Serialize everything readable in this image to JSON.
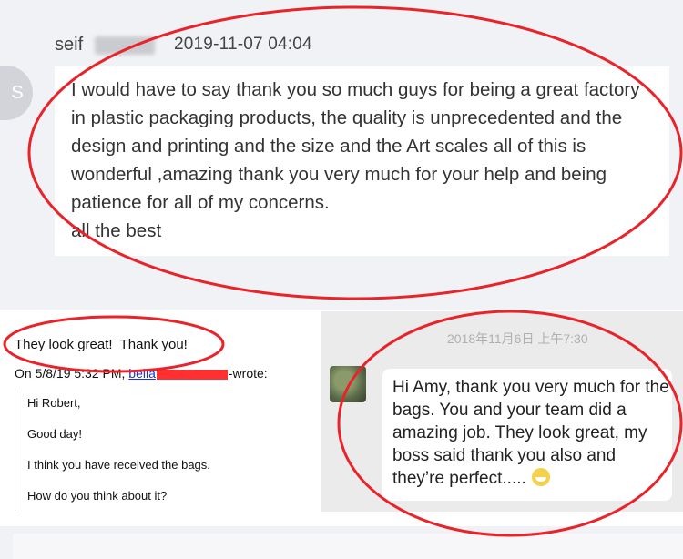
{
  "review": {
    "avatar_letter": "S",
    "author": "seif",
    "timestamp": "2019-11-07 04:04",
    "message": "I would have to say thank you so much guys for being a great factory\nin plastic packaging products, the quality is unprecedented and the\ndesign and printing and the size and the Art scales all of this is\nwonderful ,amazing thank you very much for your help and being\npatience for all of my concerns.\nall the best"
  },
  "email": {
    "reply": "They look great!  Thank you!",
    "on_prefix": "On 5/8/19 5:32 PM, ",
    "sender_link": "bella",
    "wrote": "-wrote:",
    "quoted_lines": [
      "Hi Robert,",
      "Good day!",
      "I think you have received the bags.",
      "How do you think about it?"
    ]
  },
  "chat": {
    "timestamp": "2018年11月6日 上午7:30",
    "message": "Hi Amy, thank you very much for the bags. You and your team did a amazing job. They look great, my boss said thank you also and they’re perfect.....",
    "emoji": "grin-emoji"
  },
  "colors": {
    "highlight": "#e8232a",
    "link": "#2233cc",
    "panel_bg": "#f1f2f5"
  }
}
